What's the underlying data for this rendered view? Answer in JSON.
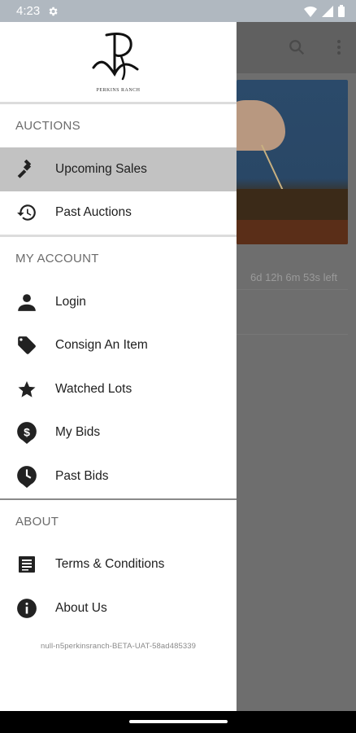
{
  "status_bar": {
    "time": "4:23",
    "icons": [
      "gear-icon",
      "wifi-icon",
      "signal-icon",
      "battery-icon"
    ]
  },
  "background_app": {
    "toolbar_icons": [
      "search-icon",
      "more-vert-icon"
    ],
    "time_left": "6d 12h 6m 53s left"
  },
  "drawer": {
    "logo": {
      "monogram": "P",
      "brand_text": "PERKINS RANCH"
    },
    "sections": [
      {
        "title": "AUCTIONS",
        "items": [
          {
            "label": "Upcoming Sales",
            "icon": "gavel-icon",
            "selected": true
          },
          {
            "label": "Past Auctions",
            "icon": "history-icon",
            "selected": false
          }
        ]
      },
      {
        "title": "MY ACCOUNT",
        "items": [
          {
            "label": "Login",
            "icon": "person-icon"
          },
          {
            "label": "Consign An Item",
            "icon": "tag-icon"
          },
          {
            "label": "Watched Lots",
            "icon": "star-icon"
          },
          {
            "label": "My Bids",
            "icon": "dollar-pin-icon"
          },
          {
            "label": "Past Bids",
            "icon": "clock-pin-icon"
          }
        ]
      },
      {
        "title": "ABOUT",
        "items": [
          {
            "label": "Terms & Conditions",
            "icon": "document-icon"
          },
          {
            "label": "About Us",
            "icon": "info-icon"
          }
        ]
      }
    ],
    "version": "null-n5perkinsranch-BETA-UAT-58ad485339"
  },
  "colors": {
    "selected_bg": "#c2c2c2",
    "scrim": "#666666",
    "section_title": "#6b6b6b"
  }
}
